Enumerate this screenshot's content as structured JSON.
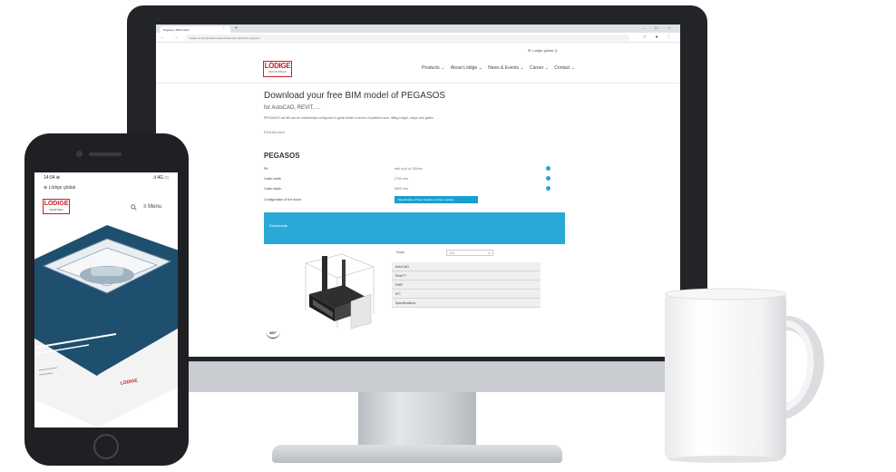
{
  "browser": {
    "tab_title": "Pegasos | BIM model",
    "tab_close": "×",
    "new_tab": "+",
    "window_controls": "– ☐ ×",
    "nav_icons": "← → C",
    "url": "lodige.com/en/products/automated-car-parks/bim-pegasos",
    "right_icons": "☆ ● ⋮"
  },
  "site": {
    "topline": "⊕ Lodige global  Q",
    "logo_main": "LÖDIGE",
    "logo_sub": "INDUSTRIES",
    "nav": [
      "Products ⌄",
      "About Lödige ⌄",
      "News & Events ⌄",
      "Career ⌄",
      "Contact ⌄"
    ],
    "title": "Download your free BIM model of PEGASOS",
    "subtitle": "for AutoCAD, REVIT, ...",
    "description": "PEGASOS car lift can be individually configured in great detail in terms of platform size, lifting height, stops and gates.",
    "fill_form": "Fill in the form.",
    "section_title": "PEGASOS",
    "config_rows": [
      {
        "label": "Pit",
        "value": "with a pit of 100mm"
      },
      {
        "label": "Cabin width",
        "value": "2700 mm"
      },
      {
        "label": "Cabin depth",
        "value": "5600 mm"
      }
    ],
    "config_floors_label": "Configuration of the floors",
    "config_floors_button": "Specification of floor heights and door variants",
    "downloads_label": "Downloads",
    "badge_360": "360°",
    "scale_label": "Scale",
    "scale_value": "1:1",
    "scale_caret": "▾",
    "formats": [
      "AutoCAD",
      "Revit™",
      "DWF",
      "IFC",
      "Specifications"
    ]
  },
  "phone": {
    "time": "14:04 ⊕",
    "signal": "⁠.ıl 4G ▭",
    "topline": "⊕ Lödige global",
    "logo_main": "LÖDIGE",
    "logo_sub": "INDUSTRIES",
    "search_icon": "search-icon",
    "menu": "≡ Menu",
    "brochure_brand": "LÖDIGE"
  },
  "colors": {
    "brand_red": "#c42126",
    "accent_blue": "#2aa9d6",
    "navy": "#1a3f6e"
  }
}
